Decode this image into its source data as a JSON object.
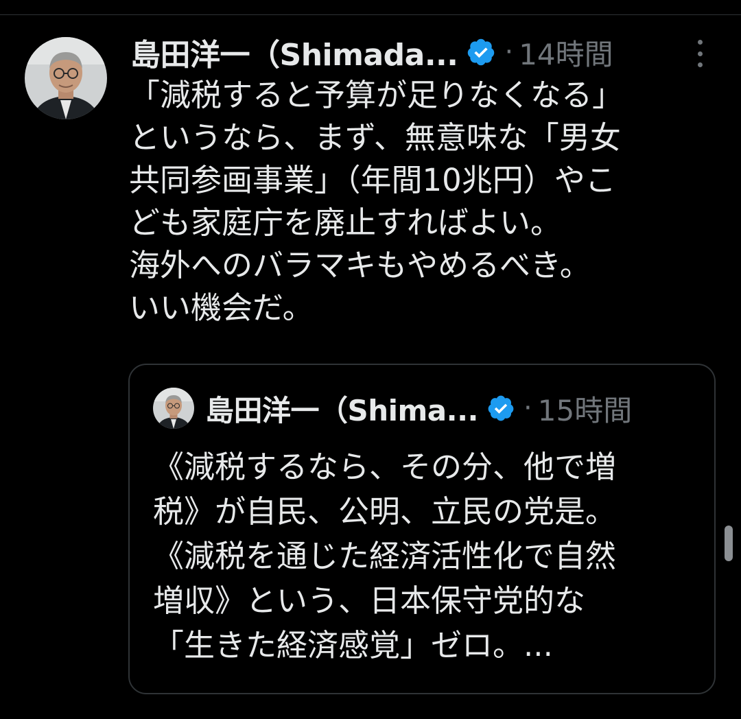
{
  "tweet": {
    "display_name": "島田洋一（Shimada...",
    "timestamp": "14時間",
    "separator": "·",
    "body_lines": [
      "「減税すると予算が足りなくなる」",
      "というなら、まず、無意味な「男女",
      "共同参画事業」（年間10兆円）やこ",
      "ども家庭庁を廃止すればよい。",
      "海外へのバラマキもやめるべき。",
      "いい機会だ。"
    ]
  },
  "quote": {
    "display_name": "島田洋一（Shima...",
    "timestamp": "15時間",
    "separator": "·",
    "body_lines": [
      "《減税するなら、その分、他で増",
      "税》が自民、公明、立民の党是。",
      "《減税を通じた経済活性化で自然",
      "増収》という、日本保守党的な",
      "「生きた経済感覚」ゼロ。..."
    ]
  },
  "icons": {
    "verified": "verified-badge-icon",
    "more": "more-options-icon"
  },
  "colors": {
    "background": "#000000",
    "text": "#e7e9ea",
    "muted": "#71767b",
    "verified": "#1d9bf0",
    "border": "#2f3336"
  }
}
